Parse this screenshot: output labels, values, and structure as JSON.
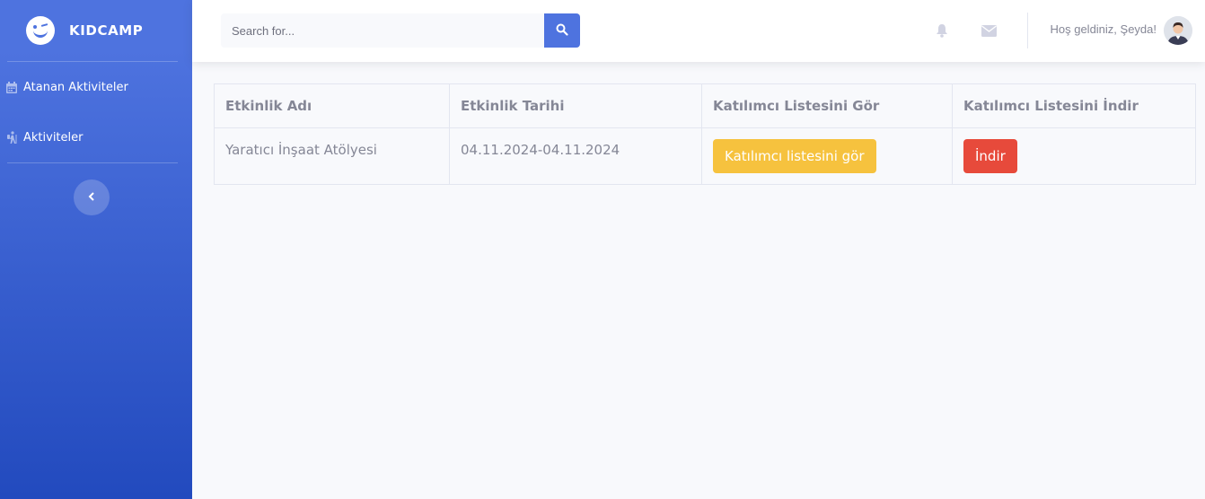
{
  "sidebar": {
    "brand": "KIDCAMP",
    "items": [
      {
        "label": "Atanan Aktiviteler",
        "icon": "calendar-icon"
      },
      {
        "label": "Aktiviteler",
        "icon": "hiking-icon"
      }
    ],
    "toggle_icon": "chevron-left-icon"
  },
  "topbar": {
    "search_placeholder": "Search for...",
    "welcome": "Hoş geldiniz, Şeyda!",
    "icons": [
      "bell-icon",
      "envelope-icon",
      "search-icon"
    ]
  },
  "table": {
    "headers": [
      "Etkinlik Adı",
      "Etkinlik Tarihi",
      "Katılımcı Listesini Gör",
      "Katılımcı Listesini İndir"
    ],
    "rows": [
      {
        "name": "Yaratıcı İnşaat Atölyesi",
        "date": "04.11.2024-04.11.2024",
        "view_button": "Katılımcı listesini gör",
        "download_button": "İndir"
      }
    ]
  },
  "colors": {
    "primary": "#4e73df",
    "warning": "#f6c23e",
    "danger": "#e74a3b"
  }
}
